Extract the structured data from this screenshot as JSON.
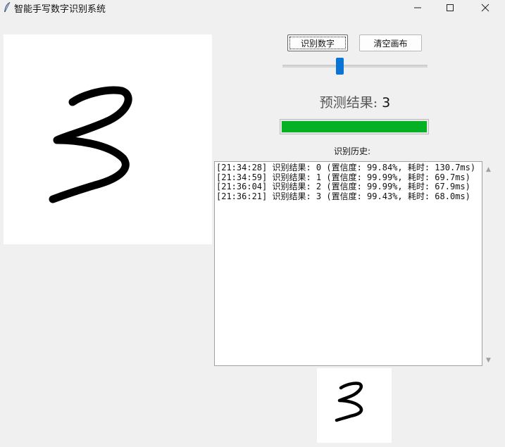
{
  "window": {
    "title": "智能手写数字识别系统",
    "minimize_icon": "minimize-icon",
    "maximize_icon": "maximize-icon",
    "close_icon": "close-icon",
    "app_icon": "feather-icon"
  },
  "toolbar": {
    "recognize_label": "识别数字",
    "clear_label": "清空画布"
  },
  "slider": {
    "value_fraction": 0.39
  },
  "result": {
    "label": "预测结果: ",
    "value": "3"
  },
  "progress": {
    "value_fraction": 1.0,
    "color": "#06b025"
  },
  "history": {
    "label": "识别历史:",
    "lines": [
      "[21:34:28] 识别结果: 0 (置信度: 99.84%, 耗时: 130.7ms)",
      "[21:34:59] 识别结果: 1 (置信度: 99.99%, 耗时: 69.7ms)",
      "[21:36:04] 识别结果: 2 (置信度: 99.99%, 耗时: 67.9ms)",
      "[21:36:21] 识别结果: 3 (置信度: 99.43%, 耗时: 68.0ms)"
    ]
  },
  "colors": {
    "accent": "#0a74d4",
    "background": "#f0f0f0"
  }
}
